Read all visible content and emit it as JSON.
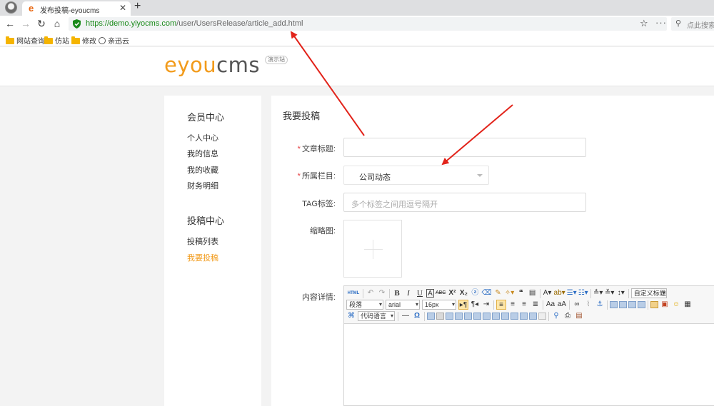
{
  "browser": {
    "tab_title": "发布投稿-eyoucms",
    "url_host": "https://demo.yiyocms.com",
    "url_path": "/user/UsersRelease/article_add.html",
    "search_placeholder": "点此搜索",
    "bookmarks": [
      "网站查询",
      "仿站",
      "修改",
      "亲迅云"
    ]
  },
  "site": {
    "logo_e": "e",
    "logo_you": "you",
    "logo_cms": "cms",
    "demo_tag": "演示站"
  },
  "sidebar": {
    "group1_title": "会员中心",
    "group1_items": [
      "个人中心",
      "我的信息",
      "我的收藏",
      "财务明细"
    ],
    "group2_title": "投稿中心",
    "group2_items": [
      "投稿列表",
      "我要投稿"
    ]
  },
  "form": {
    "page_title": "我要投稿",
    "required_mark": "*",
    "title_label": "文章标题:",
    "category_label": "所属栏目:",
    "category_value": "公司动态",
    "tag_label": "TAG标签:",
    "tag_placeholder": "多个标签之间用逗号隔开",
    "thumb_label": "缩略图:",
    "content_label": "内容详情:"
  },
  "editor": {
    "html_btn": "HTML",
    "custom_title_combo": "自定义标题",
    "paragraph_combo": "段落",
    "font_combo": "arial",
    "size_combo": "16px",
    "code_lang_combo": "代码语言"
  },
  "colors": {
    "accent": "#f29b1b",
    "required": "#e4393c",
    "secure_green": "#1a8a1a"
  }
}
